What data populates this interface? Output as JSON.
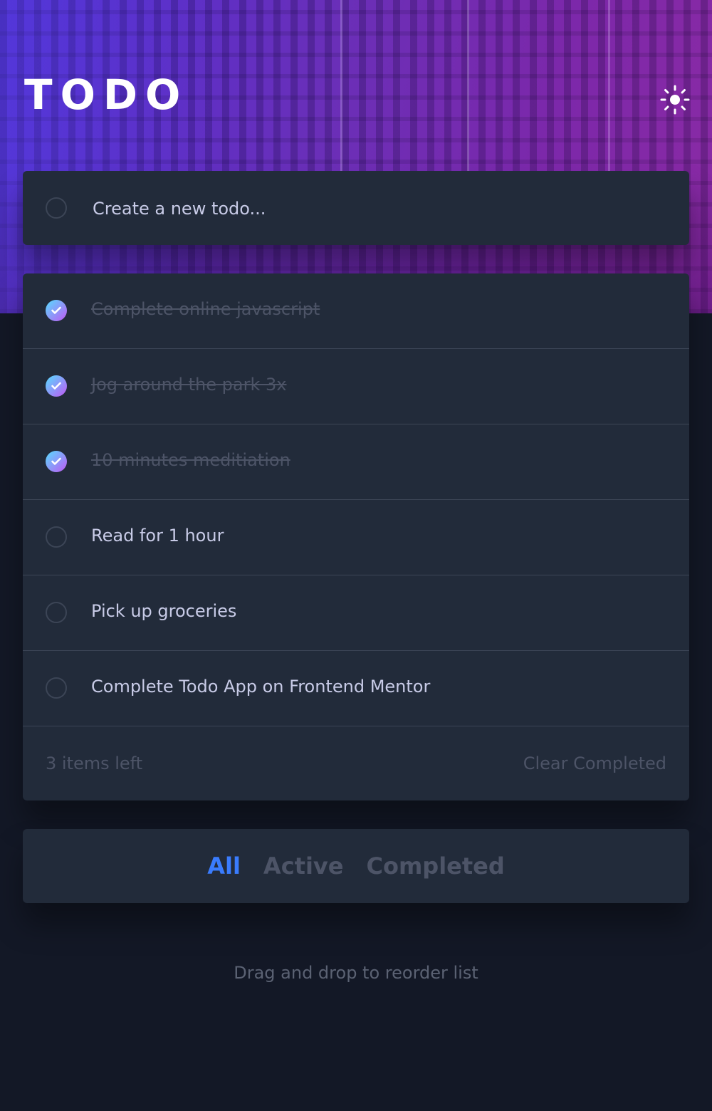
{
  "header": {
    "title": "TODO",
    "theme_icon": "sun-icon"
  },
  "new_todo": {
    "placeholder": "Create a new todo..."
  },
  "todos": [
    {
      "text": "Complete online javascript",
      "completed": true
    },
    {
      "text": "Jog around the park 3x",
      "completed": true
    },
    {
      "text": "10 minutes meditiation",
      "completed": true
    },
    {
      "text": "Read for 1 hour",
      "completed": false
    },
    {
      "text": "Pick up groceries",
      "completed": false
    },
    {
      "text": "Complete Todo App on Frontend Mentor",
      "completed": false
    }
  ],
  "footer": {
    "items_left": "3 items left",
    "clear_completed": "Clear Completed"
  },
  "filters": {
    "all": "All",
    "active": "Active",
    "completed": "Completed",
    "selected": "All"
  },
  "hint": "Drag and drop to reorder list",
  "colors": {
    "page_bg": "#131826",
    "card_bg": "#222b3a",
    "text": "#c8cbe7",
    "muted": "#4d5467",
    "accent": "#3a7cfd",
    "check_gradient_start": "#56ddff",
    "check_gradient_end": "#c058f3"
  }
}
